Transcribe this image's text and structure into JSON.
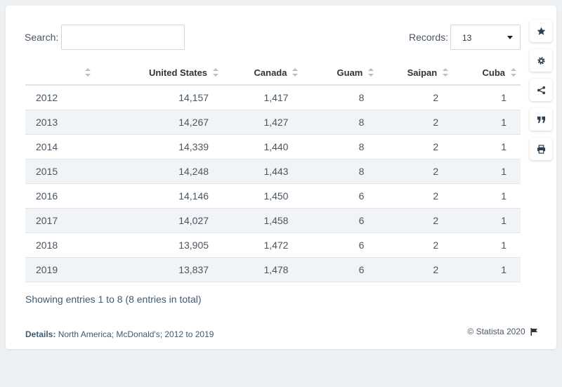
{
  "search": {
    "label": "Search:",
    "value": "",
    "placeholder": ""
  },
  "records": {
    "label": "Records:",
    "value": "13"
  },
  "table": {
    "headers": [
      "",
      "United States",
      "Canada",
      "Guam",
      "Saipan",
      "Cuba"
    ],
    "rows": [
      [
        "2012",
        "14,157",
        "1,417",
        "8",
        "2",
        "1"
      ],
      [
        "2013",
        "14,267",
        "1,427",
        "8",
        "2",
        "1"
      ],
      [
        "2014",
        "14,339",
        "1,440",
        "8",
        "2",
        "1"
      ],
      [
        "2015",
        "14,248",
        "1,443",
        "8",
        "2",
        "1"
      ],
      [
        "2016",
        "14,146",
        "1,450",
        "6",
        "2",
        "1"
      ],
      [
        "2017",
        "14,027",
        "1,458",
        "6",
        "2",
        "1"
      ],
      [
        "2018",
        "13,905",
        "1,472",
        "6",
        "2",
        "1"
      ],
      [
        "2019",
        "13,837",
        "1,478",
        "6",
        "2",
        "1"
      ]
    ]
  },
  "footer": {
    "showing": "Showing entries 1 to 8 (8 entries in total)",
    "details_label": "Details:",
    "details_text": "North America; McDonald's; 2012 to 2019",
    "copyright": "© Statista 2020"
  },
  "sidebar": {
    "icons": [
      "star-icon",
      "gear-icon",
      "share-icon",
      "quote-icon",
      "print-icon"
    ]
  },
  "colors": {
    "accent": "#3f5a72",
    "row_alt": "#f1f4f7",
    "icon": "#2d3e50"
  }
}
